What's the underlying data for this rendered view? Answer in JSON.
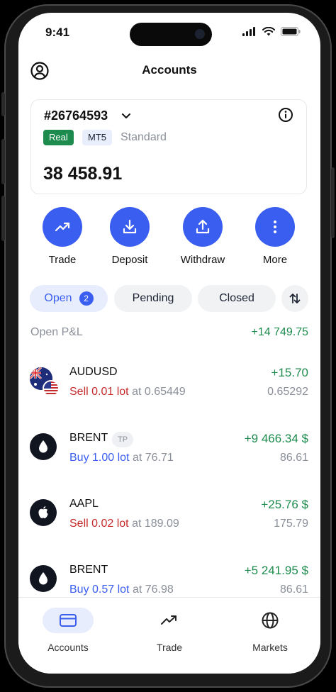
{
  "status_bar": {
    "time": "9:41"
  },
  "header": {
    "title": "Accounts"
  },
  "account": {
    "number": "#26764593",
    "badges": {
      "real": "Real",
      "platform": "MT5"
    },
    "type": "Standard",
    "balance": "38 458.91"
  },
  "actions": [
    {
      "label": "Trade",
      "icon": "trending-up-icon"
    },
    {
      "label": "Deposit",
      "icon": "download-icon"
    },
    {
      "label": "Withdraw",
      "icon": "upload-icon"
    },
    {
      "label": "More",
      "icon": "more-vertical-icon"
    }
  ],
  "filters": {
    "open": "Open",
    "open_count": "2",
    "pending": "Pending",
    "closed": "Closed"
  },
  "pnl": {
    "label": "Open P&L",
    "value": "+14 749.75"
  },
  "positions": [
    {
      "symbol": "AUDUSD",
      "side": "Sell 0.01 lot",
      "at_text": "at 0.65449",
      "profit": "+15.70",
      "current": "0.65292"
    },
    {
      "symbol": "BRENT",
      "badge": "TP",
      "side": "Buy 1.00 lot",
      "at_text": "at 76.71",
      "profit": "+9 466.34 $",
      "current": "86.61"
    },
    {
      "symbol": "AAPL",
      "side": "Sell 0.02 lot",
      "at_text": "at 189.09",
      "profit": "+25.76 $",
      "current": "175.79"
    },
    {
      "symbol": "BRENT",
      "side": "Buy 0.57 lot",
      "at_text": "at 76.98",
      "profit": "+5 241.95 $",
      "current": "86.61"
    }
  ],
  "tabs": [
    {
      "label": "Accounts"
    },
    {
      "label": "Trade"
    },
    {
      "label": "Markets"
    }
  ],
  "colors": {
    "accent": "#3a5ef0",
    "profit": "#1e8b4e",
    "sell": "#c62b2b",
    "real_badge": "#1e8b4e"
  }
}
